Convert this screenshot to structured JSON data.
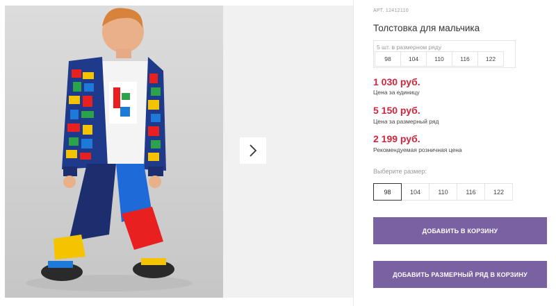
{
  "product": {
    "sku": "АРТ. 12412110",
    "title": "Толстовка для мальчика"
  },
  "pack": {
    "label": "5 шт. в размерном ряду",
    "sizes": [
      "98",
      "104",
      "110",
      "116",
      "122"
    ]
  },
  "prices": {
    "unit_price": "1 030 руб.",
    "unit_label": "Цена за единицу",
    "pack_price": "5 150 руб.",
    "pack_label": "Цена за размерный ряд",
    "retail_price": "2 199 руб.",
    "retail_label": "Рекомендуемая розничная цена"
  },
  "size_select": {
    "label": "Выберите размер:",
    "options": [
      "98",
      "104",
      "110",
      "116",
      "122"
    ],
    "selected": "98"
  },
  "buttons": {
    "add_to_cart": "ДОБАВИТЬ В КОРЗИНУ",
    "add_pack_to_cart": "ДОБАВИТЬ РАЗМЕРНЫЙ РЯД В КОРЗИНУ"
  },
  "colors": {
    "accent_button": "#7a61a1",
    "price": "#d4243b"
  },
  "icons": {
    "gallery_next": "chevron-right-icon"
  }
}
